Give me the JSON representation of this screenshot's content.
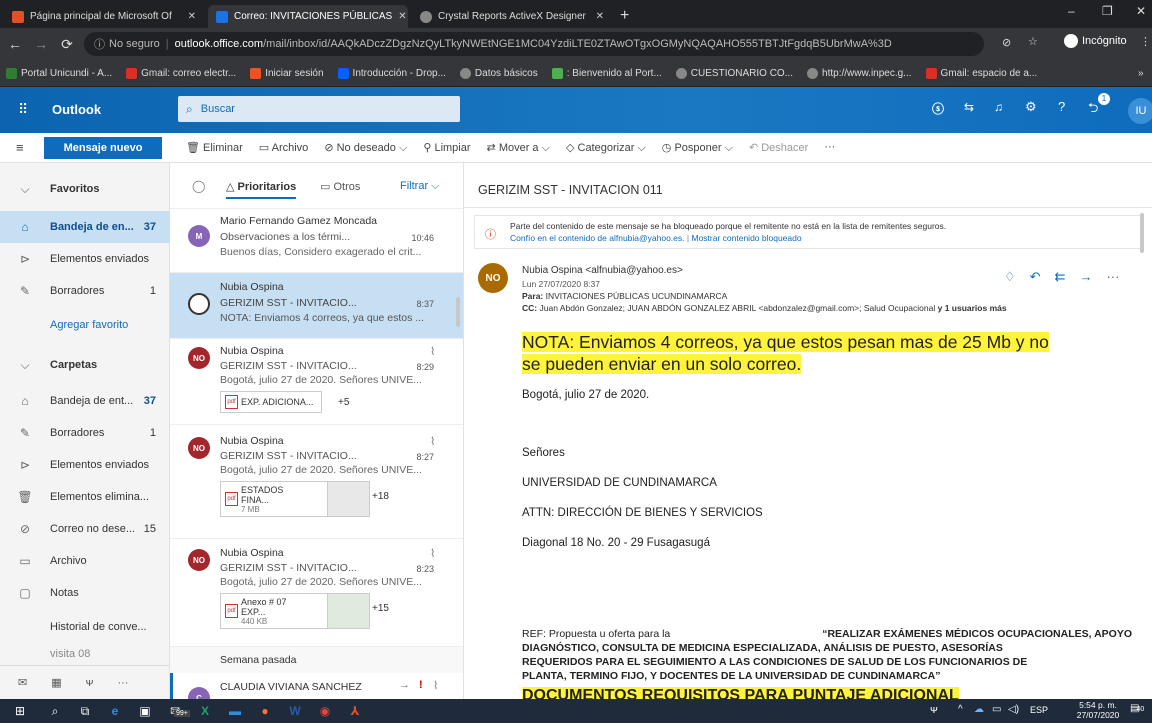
{
  "browser": {
    "tabs": [
      {
        "label": "Página principal de Microsoft Of",
        "color": "#e34f26"
      },
      {
        "label": "Correo: INVITACIONES PÚBLICAS",
        "color": "#1a73e8"
      },
      {
        "label": "Crystal Reports ActiveX Designer",
        "color": "#888888"
      }
    ],
    "new_tab": "+",
    "security": "No seguro",
    "url_host": "outlook.office.com",
    "url_path": "/mail/inbox/id/AAQkADczZDgzNzQyLTkyNWEtNGE1MC04YzdiLTE0ZTAwOTgxOGMyNQAQAHO555TBTJtFgdqB5UbrMwA%3D",
    "incognito": "Incógnito",
    "bookmarks": [
      {
        "label": "Portal Unicundi - A...",
        "color": "#2e7d32"
      },
      {
        "label": "Gmail: correo electr...",
        "color": "#d93025"
      },
      {
        "label": "Iniciar sesión",
        "color": "#f25022"
      },
      {
        "label": "Introducción - Drop...",
        "color": "#0061ff"
      },
      {
        "label": "Datos básicos",
        "color": "#888888"
      },
      {
        "label": ": Bienvenido al Port...",
        "color": "#4caf50"
      },
      {
        "label": "CUESTIONARIO CO...",
        "color": "#888888"
      },
      {
        "label": "http://www.inpec.g...",
        "color": "#888888"
      },
      {
        "label": "Gmail: espacio de a...",
        "color": "#d93025"
      }
    ]
  },
  "outlook": {
    "brand": "Outlook",
    "search_placeholder": "Buscar",
    "user_initials": "IU",
    "notif_count": "1"
  },
  "commands": {
    "new_message": "Mensaje nuevo",
    "delete": "Eliminar",
    "archive": "Archivo",
    "junk": "No deseado",
    "clean": "Limpiar",
    "move": "Mover a",
    "categorize": "Categorizar",
    "postpone": "Posponer",
    "undo": "Deshacer",
    "more": "···"
  },
  "leftnav": {
    "favorites": "Favoritos",
    "inbox_fav": {
      "label": "Bandeja de en...",
      "count": "37"
    },
    "sent_fav": "Elementos enviados",
    "drafts_fav": {
      "label": "Borradores",
      "count": "1"
    },
    "add_fav": "Agregar favorito",
    "folders": "Carpetas",
    "inbox": {
      "label": "Bandeja de ent...",
      "count": "37"
    },
    "drafts": {
      "label": "Borradores",
      "count": "1"
    },
    "sent": "Elementos enviados",
    "deleted": "Elementos elimina...",
    "junk": {
      "label": "Correo no dese...",
      "count": "15"
    },
    "archive": "Archivo",
    "notes": "Notas",
    "history": "Historial de conve...",
    "visit": "visita 08"
  },
  "msglist": {
    "focused": "Prioritarios",
    "other": "Otros",
    "filter": "Filtrar",
    "last_week": "Semana pasada",
    "messages": [
      {
        "sender": "Mario Fernando Gamez Moncada",
        "subject": "Observaciones a los térmi...",
        "time": "10:46",
        "preview": "Buenos días, Considero exagerado el crit...",
        "initials": "M",
        "color": "#8764b8"
      },
      {
        "sender": "Nubia Ospina",
        "subject": "GERIZIM SST - INVITACIO...",
        "time": "8:37",
        "preview": "NOTA: Enviamos 4 correos, ya que estos ...",
        "initials": "",
        "color": "#ffffff"
      },
      {
        "sender": "Nubia Ospina",
        "subject": "GERIZIM SST - INVITACIO...",
        "time": "8:29",
        "preview": "Bogotá, julio 27 de 2020. Señores UNIVE...",
        "initials": "NO",
        "color": "#a4262c",
        "attach": "EXP. ADICIONA...",
        "more": "+5"
      },
      {
        "sender": "Nubia Ospina",
        "subject": "GERIZIM SST - INVITACIO...",
        "time": "8:27",
        "preview": "Bogotá, julio 27 de 2020. Señores UNIVE...",
        "initials": "NO",
        "color": "#a4262c",
        "attach": "ESTADOS FINA...",
        "size": "7 MB",
        "more": "+18"
      },
      {
        "sender": "Nubia Ospina",
        "subject": "GERIZIM SST - INVITACIO...",
        "time": "8:23",
        "preview": "Bogotá, julio 27 de 2020. Señores UNIVE...",
        "initials": "NO",
        "color": "#a4262c",
        "attach": "Anexo # 07 EXP...",
        "size": "440 KB",
        "more": "+15"
      },
      {
        "sender": "CLAUDIA VIVIANA SANCHEZ",
        "subject": "",
        "time": "",
        "preview": "",
        "initials": "C",
        "color": "#8764b8"
      }
    ]
  },
  "reading": {
    "subject": "GERIZIM SST - INVITACION 011",
    "blocked": "Parte del contenido de este mensaje se ha bloqueado porque el remitente no está en la lista de remitentes seguros.",
    "trust": "Confío en el contenido de alfnubia@yahoo.es.",
    "show_blocked": "Mostrar contenido bloqueado",
    "from": "Nubia Ospina <alfnubia@yahoo.es>",
    "date": "Lun 27/07/2020 8:37",
    "to_label": "Para:",
    "to": "INVITACIONES PÚBLICAS UCUNDINAMARCA",
    "cc_label": "CC:",
    "cc": "Juan Abdón Gonzalez; JUAN ABDÓN GONZALEZ ABRIL <abdonzalez@gmail.com>; Salud Ocupacional",
    "cc_more": "y 1 usuarios más",
    "initials": "NO",
    "note1": "NOTA: Enviamos 4 correos, ya que estos pesan mas de 25 Mb y no",
    "note2": "se pueden enviar en un solo correo.",
    "date_line": "Bogotá, julio 27 de 2020.",
    "greeting": "Señores",
    "org": "UNIVERSIDAD DE CUNDINAMARCA",
    "attn": "ATTN: DIRECCIÓN DE BIENES Y SERVICIOS",
    "address": "Diagonal 18 No. 20 - 29 Fusagasugá",
    "ref_prefix": "REF: Propuesta u oferta para la ",
    "ref_line1": "“REALIZAR EXÁMENES MÉDICOS OCUPACIONALES, APOYO",
    "ref_line2": "DIAGNÓSTICO, CONSULTA DE MEDICINA ESPECIALIZADA, ANÁLISIS DE PUESTO, ASESORÍAS",
    "ref_line3": "REQUERIDOS PARA EL SEGUIMIENTO A LAS CONDICIONES DE SALUD DE LOS FUNCIONARIOS DE",
    "ref_line4": "PLANTA, TERMINO FIJO, Y DOCENTES DE LA UNIVERSIDAD DE CUNDINAMARCA”",
    "docs": "DOCUMENTOS REQUISITOS PARA PUNTAJE ADICIONAL"
  },
  "taskbar": {
    "lang": "ESP",
    "time": "5:54 p. m.",
    "date": "27/07/2020",
    "badge": "99+",
    "notif": "40"
  }
}
